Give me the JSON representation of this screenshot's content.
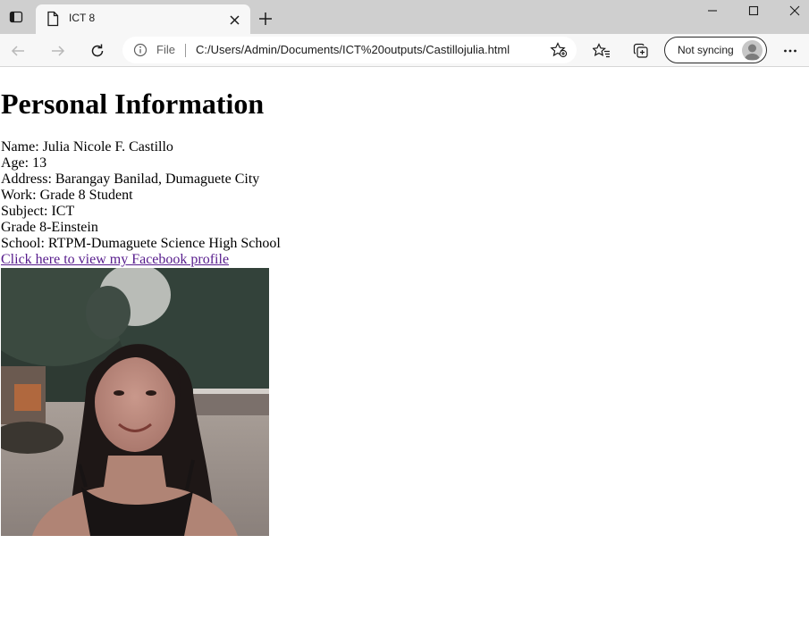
{
  "browser": {
    "tab_title": "ICT 8",
    "address_label": "File",
    "url": "C:/Users/Admin/Documents/ICT%20outputs/Castillojulia.html",
    "sync_label": "Not syncing"
  },
  "page": {
    "heading": "Personal Information",
    "lines": [
      "Name: Julia Nicole F. Castillo",
      "Age: 13",
      "Address: Barangay Banilad, Dumaguete City",
      "Work: Grade 8 Student",
      "Subject: ICT",
      "Grade 8-Einstein",
      "School: RTPM-Dumaguete Science High School"
    ],
    "link_text": "Click here to view my Facebook profile",
    "link_color": "#551a8b"
  }
}
